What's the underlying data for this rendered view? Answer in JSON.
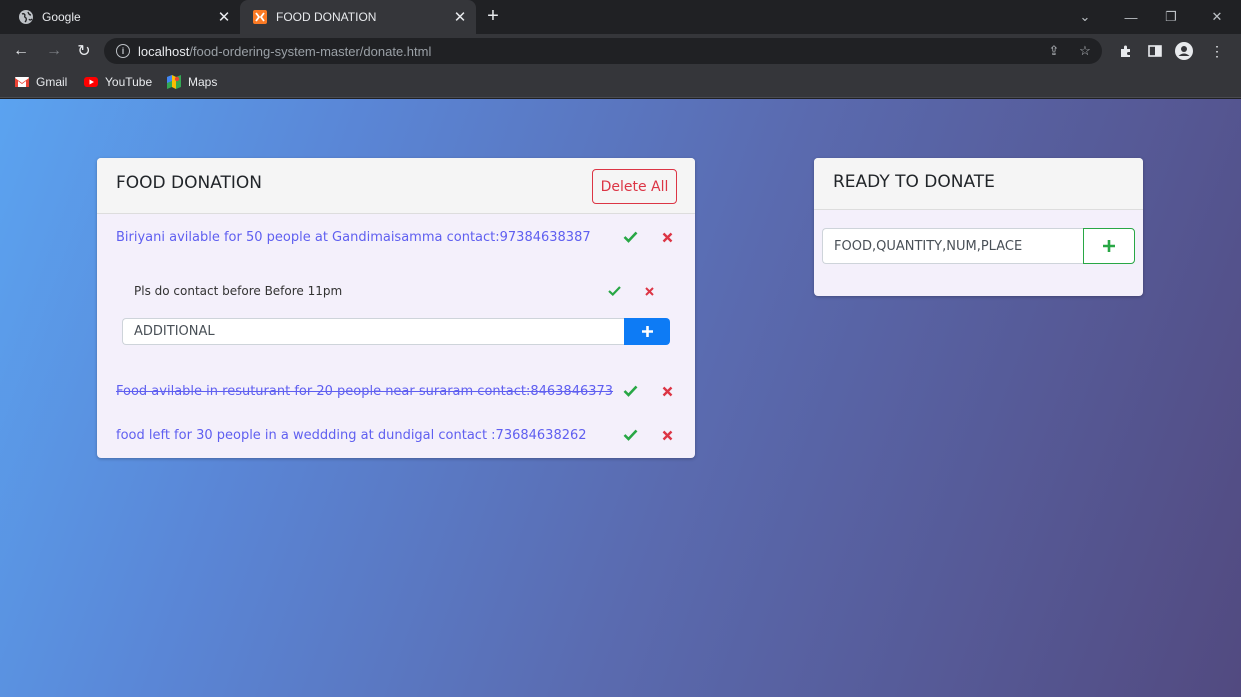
{
  "browser": {
    "tabs": [
      {
        "title": "Google",
        "active": false
      },
      {
        "title": "FOOD DONATION",
        "active": true
      }
    ],
    "url_host": "localhost",
    "url_path": "/food-ordering-system-master/donate.html",
    "bookmarks": [
      {
        "label": "Gmail",
        "icon": "gmail-icon"
      },
      {
        "label": "YouTube",
        "icon": "youtube-icon"
      },
      {
        "label": "Maps",
        "icon": "maps-icon"
      }
    ]
  },
  "donation_card": {
    "title": "FOOD DONATION",
    "delete_all_label": "Delete All",
    "items": [
      {
        "text": "Biriyani avilable for 50 people at Gandimaisamma contact:97384638387",
        "completed": false
      },
      {
        "text": "Food avilable in resuturant for 20 people near suraram contact:8463846373",
        "completed": true
      },
      {
        "text": "food left for 30 people in a weddding at dundigal contact :73684638262",
        "completed": false
      }
    ],
    "sub_item": {
      "text": "Pls do contact before Before 11pm"
    },
    "additional_input": {
      "placeholder": "ADDITIONAL"
    }
  },
  "ready_card": {
    "title": "READY TO DONATE",
    "input": {
      "placeholder": "FOOD,QUANTITY,NUM,PLACE"
    }
  },
  "colors": {
    "check": "#28a745",
    "delete": "#dc3545",
    "primary": "#0d7bf5",
    "item_text": "#5f5ff0"
  }
}
